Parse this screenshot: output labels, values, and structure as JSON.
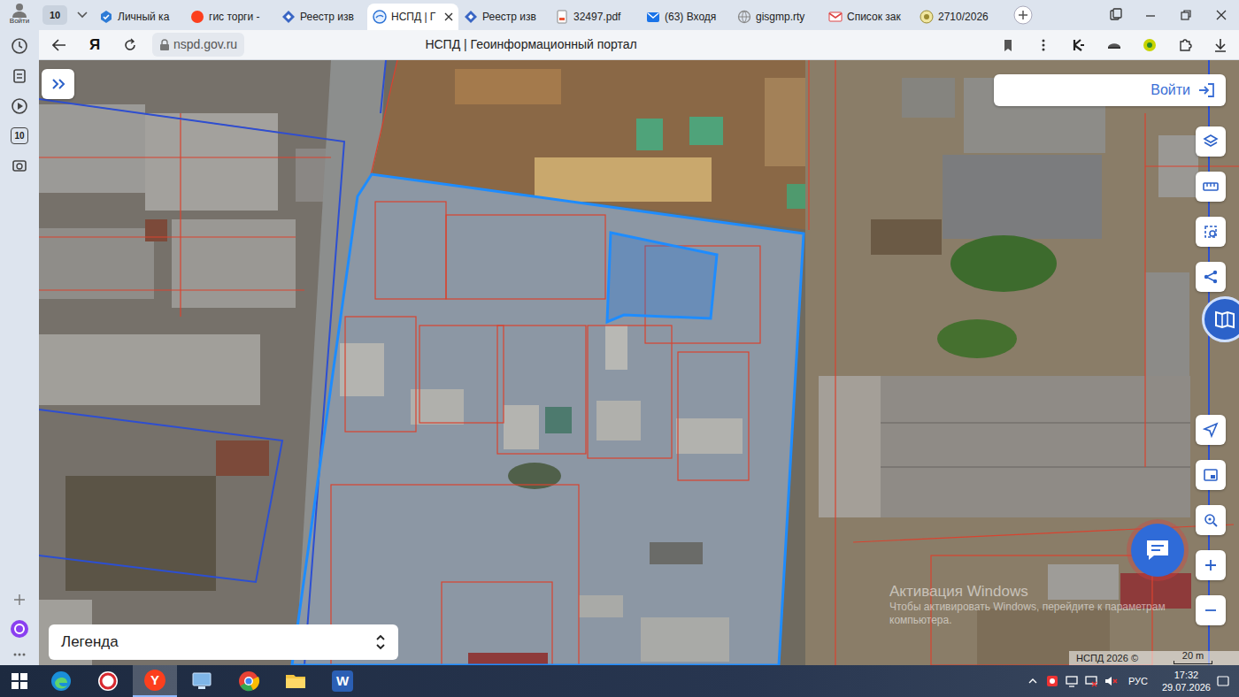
{
  "sidebar": {
    "login": "Войти",
    "counter": "10"
  },
  "browser": {
    "tab_count": "10",
    "tabs": [
      {
        "label": "Личный ка",
        "kind": "service",
        "selected": false
      },
      {
        "label": "гис торги -",
        "kind": "yandex",
        "selected": false
      },
      {
        "label": "Реестр изв",
        "kind": "registry",
        "selected": false
      },
      {
        "label": "НСПД | Г",
        "kind": "nspd",
        "selected": true
      },
      {
        "label": "Реестр изв",
        "kind": "registry",
        "selected": false
      },
      {
        "label": "32497.pdf",
        "kind": "pdf",
        "selected": false
      },
      {
        "label": "(63) Входя",
        "kind": "mail",
        "selected": false
      },
      {
        "label": "gisgmp.rty",
        "kind": "globe",
        "selected": false
      },
      {
        "label": "Список зак",
        "kind": "gmail",
        "selected": false
      },
      {
        "label": "2710/2026",
        "kind": "doc",
        "selected": false
      }
    ],
    "logo": "Я",
    "address": "nspd.gov.ru",
    "page_title": "НСПД | Геоинформационный портал"
  },
  "map": {
    "login": "Войти",
    "legend": "Легенда",
    "copyright": "НСПД 2026 ©",
    "scale": "20 m"
  },
  "watermark": {
    "title": "Активация Windows",
    "line1": "Чтобы активировать Windows, перейдите к параметрам",
    "line2": "компьютера."
  },
  "taskbar": {
    "apps": [
      {
        "kind": "edge",
        "selected": false
      },
      {
        "kind": "red",
        "selected": false
      },
      {
        "kind": "yandex",
        "letter": "Y",
        "selected": true
      },
      {
        "kind": "remote",
        "selected": false
      },
      {
        "kind": "chrome",
        "selected": false
      },
      {
        "kind": "explorer",
        "selected": false
      },
      {
        "kind": "word",
        "letter": "W",
        "selected": false
      }
    ],
    "language": "РУС",
    "time": "17:32",
    "date": "29.07.2026"
  }
}
